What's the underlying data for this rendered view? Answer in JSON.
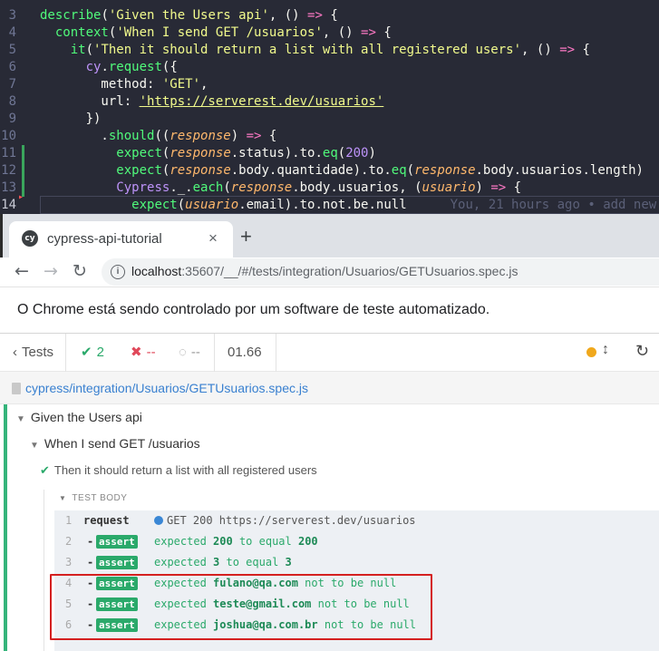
{
  "editor": {
    "lines": [
      {
        "num": "3",
        "html": "<span class='k-grn'>describe</span>(<span class='k-yel'>'Given the Users api'</span>, () <span class='k-pink'>=&gt;</span> {"
      },
      {
        "num": "4",
        "html": "  <span class='k-grn'>context</span>(<span class='k-yel'>'When I send GET /usuarios'</span>, () <span class='k-pink'>=&gt;</span> {"
      },
      {
        "num": "5",
        "html": "    <span class='k-grn'>it</span>(<span class='k-yel'>'Then it should return a list with all registered users'</span>, () <span class='k-pink'>=&gt;</span> {"
      },
      {
        "num": "6",
        "html": "      <span class='k-pur'>cy</span>.<span class='k-grn'>request</span>({"
      },
      {
        "num": "7",
        "html": "        method: <span class='k-yel'>'GET'</span>,"
      },
      {
        "num": "8",
        "html": "        url: <span class='k-url'>'https://serverest.dev/usuarios'</span>"
      },
      {
        "num": "9",
        "html": "      })"
      },
      {
        "num": "10",
        "html": "        .<span class='k-grn'>should</span>((<span class='k-org'>response</span>) <span class='k-pink'>=&gt;</span> {"
      },
      {
        "num": "11",
        "html": "          <span class='k-grn'>expect</span>(<span class='k-org'>response</span>.status).to.<span class='k-grn'>eq</span>(<span class='k-pur'>200</span>)"
      },
      {
        "num": "12",
        "html": "          <span class='k-grn'>expect</span>(<span class='k-org'>response</span>.body.quantidade).to.<span class='k-grn'>eq</span>(<span class='k-org'>response</span>.body.usuarios.length)"
      },
      {
        "num": "13",
        "html": "          <span class='k-pur'>Cypress</span>._.<span class='k-grn'>each</span>(<span class='k-org'>response</span>.body.usuarios, (<span class='k-org'>usuario</span>) <span class='k-pink'>=&gt;</span> {"
      },
      {
        "num": "14",
        "html": "            <span class='k-grn'>expect</span>(<span class='k-org'>usuario</span>.email).to.not.be.null<span class='blame'>You, 21 hours ago • add new</span>"
      }
    ]
  },
  "browser": {
    "tab_favicon": "cy",
    "tab_title": "cypress-api-tutorial",
    "tab_close": "×",
    "new_tab": "+",
    "back": "←",
    "forward": "→",
    "reload": "↻",
    "info": "i",
    "url_host": "localhost",
    "url_rest": ":35607/__/#/tests/integration/Usuarios/GETUsuarios.spec.js",
    "infobar": "O Chrome está sendo controlado por um software de teste automatizado."
  },
  "runner": {
    "tests_label": "Tests",
    "passed": "2",
    "failed": "--",
    "pending": "--",
    "duration": "01.66",
    "spec_path": "cypress/integration/Usuarios/GETUsuarios.spec.js",
    "suite1": "Given the Users api",
    "suite2": "When I send GET /usuarios",
    "test": "Then it should return a list with all registered users",
    "body_label": "TEST BODY",
    "commands": [
      {
        "num": "1",
        "name": "request",
        "method": "GET 200 https://serverest.dev/usuarios"
      },
      {
        "num": "2",
        "name": "assert",
        "pre": "expected ",
        "a": "200",
        "mid": " to equal ",
        "b": "200"
      },
      {
        "num": "3",
        "name": "assert",
        "pre": "expected ",
        "a": "3",
        "mid": " to equal ",
        "b": "3"
      },
      {
        "num": "4",
        "name": "assert",
        "pre": "expected ",
        "a": "fulano@qa.com",
        "mid": " not to be null",
        "b": ""
      },
      {
        "num": "5",
        "name": "assert",
        "pre": "expected ",
        "a": "teste@gmail.com",
        "mid": " not to be null",
        "b": ""
      },
      {
        "num": "6",
        "name": "assert",
        "pre": "expected ",
        "a": "joshua@qa.com.br",
        "mid": " not to be null",
        "b": ""
      }
    ]
  },
  "colors": {
    "accent": "#2aa96a",
    "highlight": "#d42020",
    "editor_bg": "#282a36"
  }
}
